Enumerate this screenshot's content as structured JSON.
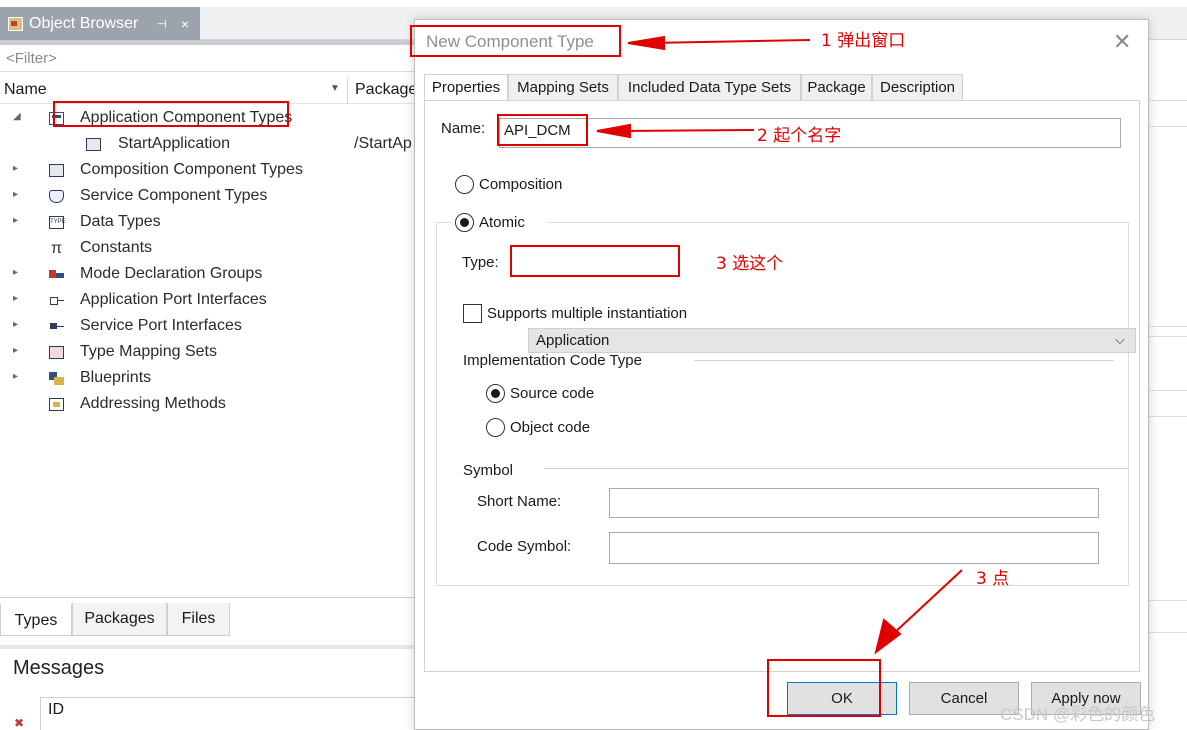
{
  "object_browser": {
    "tab_title": "Object Browser",
    "pin_symbol": "⊣",
    "close_symbol": "×",
    "filter_placeholder": "<Filter>",
    "col_name": "Name",
    "col_package": "Package",
    "tree": [
      {
        "label": "Application Component Types",
        "expanded": true,
        "icon": "application-component-types-icon"
      },
      {
        "label": "StartApplication",
        "package": "/StartAp",
        "child": true,
        "icon": "application-component-icon"
      },
      {
        "label": "Composition Component Types",
        "icon": "composition-icon"
      },
      {
        "label": "Service Component Types",
        "icon": "service-component-icon"
      },
      {
        "label": "Data Types",
        "icon": "data-type-icon"
      },
      {
        "label": "Constants",
        "icon": "pi-constant-icon"
      },
      {
        "label": "Mode Declaration Groups",
        "icon": "mode-group-icon"
      },
      {
        "label": "Application Port Interfaces",
        "icon": "port-interface-icon"
      },
      {
        "label": "Service Port Interfaces",
        "icon": "service-port-icon"
      },
      {
        "label": "Type Mapping Sets",
        "icon": "type-mapping-icon"
      },
      {
        "label": "Blueprints",
        "icon": "blueprint-icon"
      },
      {
        "label": "Addressing Methods",
        "icon": "addressing-method-icon"
      }
    ],
    "bottom_tabs": [
      "Types",
      "Packages",
      "Files"
    ],
    "messages_title": "Messages",
    "messages_col_id": "ID"
  },
  "dialog": {
    "title": "New Component Type",
    "tabs": [
      "Properties",
      "Mapping Sets",
      "Included Data Type Sets",
      "Package",
      "Description"
    ],
    "active_tab": "Properties",
    "name_label": "Name:",
    "name_value": "API_DCM",
    "composition_label": "Composition",
    "atomic_label": "Atomic",
    "type_label": "Type:",
    "type_value": "Application",
    "supports_multiple_label": "Supports multiple instantiation",
    "impl_code_type_label": "Implementation Code Type",
    "source_code_label": "Source code",
    "object_code_label": "Object code",
    "symbol_label": "Symbol",
    "short_name_label": "Short Name:",
    "short_name_value": "",
    "code_symbol_label": "Code Symbol:",
    "code_symbol_value": "",
    "ok_label": "OK",
    "cancel_label": "Cancel",
    "apply_label": "Apply now"
  },
  "annotations": {
    "step1": "1  弹出窗口",
    "step2": "2  起个名字",
    "step3_select": "3  选这个",
    "step3_click": "3  点",
    "color": "#e00000"
  },
  "watermark": "CSDN @彩色的颜色"
}
